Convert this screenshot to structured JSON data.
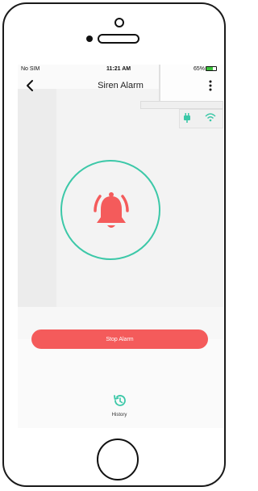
{
  "status_bar": {
    "carrier": "No SIM",
    "time": "11:21 AM",
    "battery_percent": "65%",
    "battery_level": 0.65
  },
  "nav": {
    "title": "Siren Alarm",
    "back_icon": "chevron-left-icon",
    "menu_icon": "more-vertical-icon"
  },
  "scene": {
    "hub_icons": [
      "plug-icon",
      "wifi-icon"
    ]
  },
  "alarm": {
    "icon": "bell-ringing-icon",
    "ring_color": "#3cc8a8",
    "bell_color": "#f45b5b"
  },
  "actions": {
    "stop_label": "Stop Alarm",
    "stop_color": "#f45b5b"
  },
  "history": {
    "icon": "history-icon",
    "label": "History",
    "color": "#3cc8a8"
  }
}
